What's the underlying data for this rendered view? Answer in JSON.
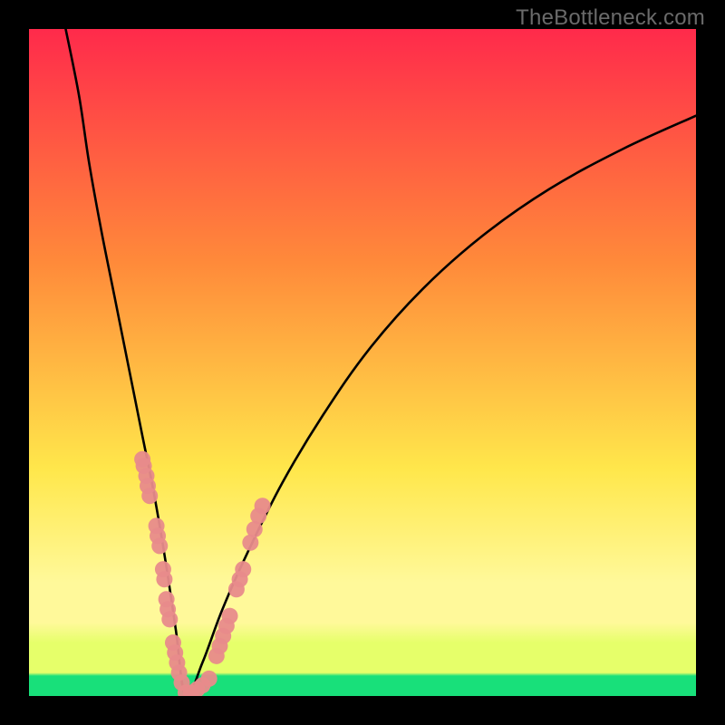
{
  "watermark": "TheBottleneck.com",
  "colors": {
    "gradient_top": "#ff2a4b",
    "gradient_mid1": "#ff8a3a",
    "gradient_mid2": "#ffe74b",
    "gradient_lowband_top": "#fff99a",
    "gradient_5pct": "#e6ff6a",
    "gradient_0pct": "#18e07a",
    "curve": "#000000",
    "marker_fill": "#e88b8b",
    "marker_stroke": "#d96f6f",
    "frame": "#000000"
  },
  "chart_data": {
    "type": "line",
    "title": "",
    "xlabel": "",
    "ylabel": "",
    "x_range_fraction": [
      0.0,
      1.0
    ],
    "y_percent_range": [
      0,
      100
    ],
    "curve_minimum_x_fraction": 0.235,
    "curve_minimum_y_percent": 0,
    "left_curve_points": [
      {
        "x": 0.055,
        "y": 100.0
      },
      {
        "x": 0.075,
        "y": 90.0
      },
      {
        "x": 0.09,
        "y": 80.0
      },
      {
        "x": 0.108,
        "y": 70.0
      },
      {
        "x": 0.128,
        "y": 60.0
      },
      {
        "x": 0.148,
        "y": 50.0
      },
      {
        "x": 0.168,
        "y": 40.0
      },
      {
        "x": 0.188,
        "y": 30.0
      },
      {
        "x": 0.205,
        "y": 20.0
      },
      {
        "x": 0.22,
        "y": 10.0
      },
      {
        "x": 0.235,
        "y": 0.0
      }
    ],
    "right_curve_points": [
      {
        "x": 0.235,
        "y": 0.0
      },
      {
        "x": 0.26,
        "y": 5.0
      },
      {
        "x": 0.29,
        "y": 13.0
      },
      {
        "x": 0.33,
        "y": 22.0
      },
      {
        "x": 0.38,
        "y": 32.0
      },
      {
        "x": 0.44,
        "y": 42.0
      },
      {
        "x": 0.51,
        "y": 52.0
      },
      {
        "x": 0.59,
        "y": 61.0
      },
      {
        "x": 0.68,
        "y": 69.0
      },
      {
        "x": 0.78,
        "y": 76.0
      },
      {
        "x": 0.89,
        "y": 82.0
      },
      {
        "x": 1.0,
        "y": 87.0
      }
    ],
    "marker_clusters": [
      {
        "side": "left",
        "points": [
          {
            "x": 0.17,
            "y": 35.5
          },
          {
            "x": 0.172,
            "y": 34.5
          },
          {
            "x": 0.176,
            "y": 33.0
          },
          {
            "x": 0.178,
            "y": 31.5
          },
          {
            "x": 0.181,
            "y": 30.0
          }
        ]
      },
      {
        "side": "left",
        "points": [
          {
            "x": 0.191,
            "y": 25.5
          },
          {
            "x": 0.193,
            "y": 24.0
          },
          {
            "x": 0.196,
            "y": 22.5
          }
        ]
      },
      {
        "side": "left",
        "points": [
          {
            "x": 0.201,
            "y": 19.0
          },
          {
            "x": 0.203,
            "y": 17.5
          }
        ]
      },
      {
        "side": "left",
        "points": [
          {
            "x": 0.206,
            "y": 14.5
          },
          {
            "x": 0.208,
            "y": 13.0
          },
          {
            "x": 0.211,
            "y": 11.5
          }
        ]
      },
      {
        "side": "left",
        "points": [
          {
            "x": 0.216,
            "y": 8.0
          },
          {
            "x": 0.219,
            "y": 6.5
          },
          {
            "x": 0.222,
            "y": 5.0
          },
          {
            "x": 0.225,
            "y": 3.5
          },
          {
            "x": 0.229,
            "y": 2.0
          }
        ]
      },
      {
        "side": "bottom",
        "points": [
          {
            "x": 0.235,
            "y": 0.5
          },
          {
            "x": 0.243,
            "y": 0.5
          },
          {
            "x": 0.252,
            "y": 1.0
          },
          {
            "x": 0.26,
            "y": 1.6
          },
          {
            "x": 0.27,
            "y": 2.6
          }
        ]
      },
      {
        "side": "right",
        "points": [
          {
            "x": 0.281,
            "y": 6.0
          },
          {
            "x": 0.286,
            "y": 7.5
          },
          {
            "x": 0.291,
            "y": 9.0
          },
          {
            "x": 0.296,
            "y": 10.5
          },
          {
            "x": 0.301,
            "y": 12.0
          }
        ]
      },
      {
        "side": "right",
        "points": [
          {
            "x": 0.311,
            "y": 16.0
          },
          {
            "x": 0.316,
            "y": 17.5
          },
          {
            "x": 0.321,
            "y": 19.0
          }
        ]
      },
      {
        "side": "right",
        "points": [
          {
            "x": 0.332,
            "y": 23.0
          },
          {
            "x": 0.338,
            "y": 25.0
          },
          {
            "x": 0.344,
            "y": 27.0
          },
          {
            "x": 0.35,
            "y": 28.5
          }
        ]
      }
    ]
  }
}
